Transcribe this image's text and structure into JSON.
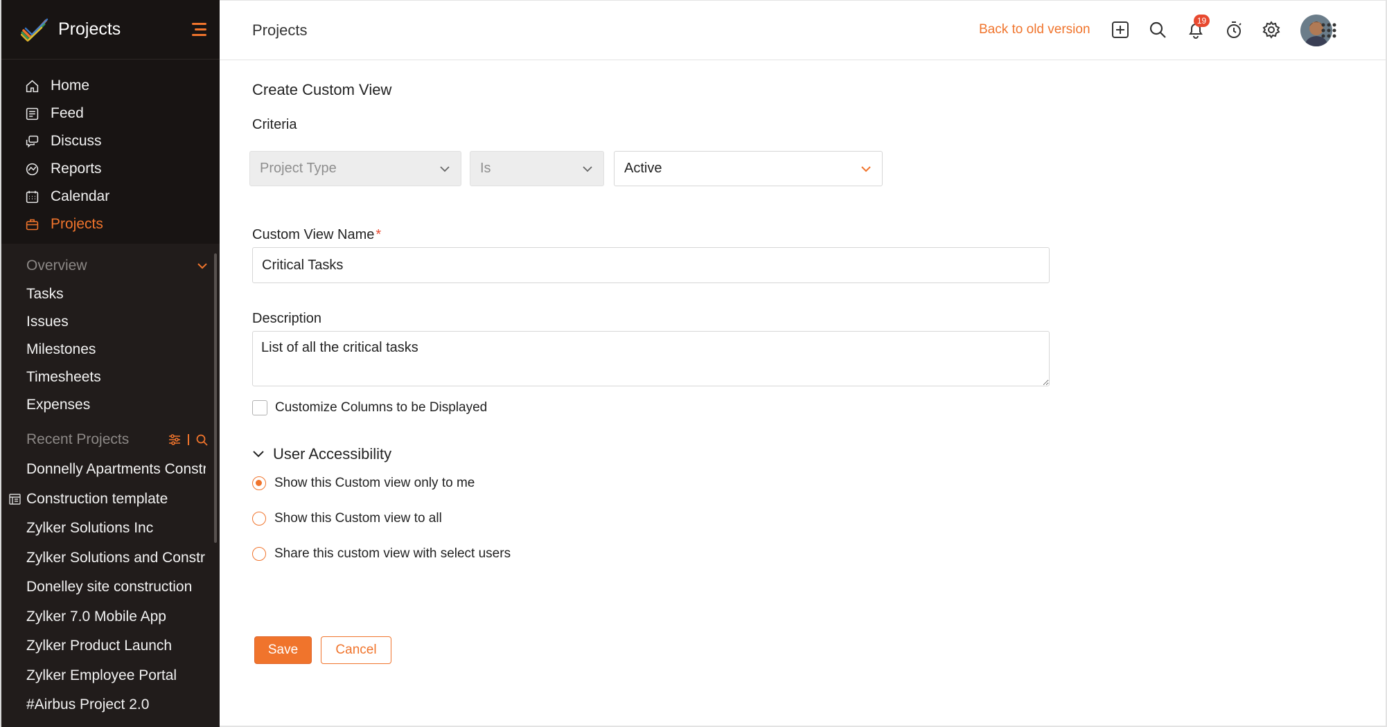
{
  "app": {
    "title": "Projects"
  },
  "sidebar": {
    "nav": [
      {
        "label": "Home",
        "icon": "home-icon"
      },
      {
        "label": "Feed",
        "icon": "feed-icon"
      },
      {
        "label": "Discuss",
        "icon": "discuss-icon"
      },
      {
        "label": "Reports",
        "icon": "reports-icon"
      },
      {
        "label": "Calendar",
        "icon": "calendar-icon"
      },
      {
        "label": "Projects",
        "icon": "briefcase-icon",
        "active": true
      }
    ],
    "overview": {
      "heading": "Overview",
      "items": [
        "Tasks",
        "Issues",
        "Milestones",
        "Timesheets",
        "Expenses"
      ]
    },
    "recent": {
      "heading": "Recent Projects",
      "items": [
        "Donnelly Apartments Construction",
        "Construction template",
        "Zylker Solutions Inc",
        "Zylker Solutions and Construction",
        "Donelley site construction",
        "Zylker 7.0 Mobile App",
        "Zylker Product Launch",
        "Zylker Employee Portal",
        "#Airbus Project 2.0"
      ]
    }
  },
  "header": {
    "title": "Projects",
    "back_link": "Back to old version",
    "notification_count": "19"
  },
  "form": {
    "title": "Create Custom View",
    "criteria_label": "Criteria",
    "criteria": {
      "field": "Project Type",
      "operator": "Is",
      "value": "Active"
    },
    "name_label": "Custom View Name",
    "required_mark": "*",
    "name_value": "Critical Tasks",
    "description_label": "Description",
    "description_value": "List of all the critical tasks",
    "customize_columns_label": "Customize Columns to be Displayed",
    "accessibility_heading": "User Accessibility",
    "accessibility_options": [
      "Show this Custom view only to me",
      "Show this Custom view to all",
      "Share this custom view with select users"
    ],
    "save_label": "Save",
    "cancel_label": "Cancel"
  },
  "colors": {
    "accent": "#f0742c",
    "sidebar_bg": "#181413",
    "sidebar_sub_bg": "#211c1b",
    "badge": "#e8492f"
  }
}
